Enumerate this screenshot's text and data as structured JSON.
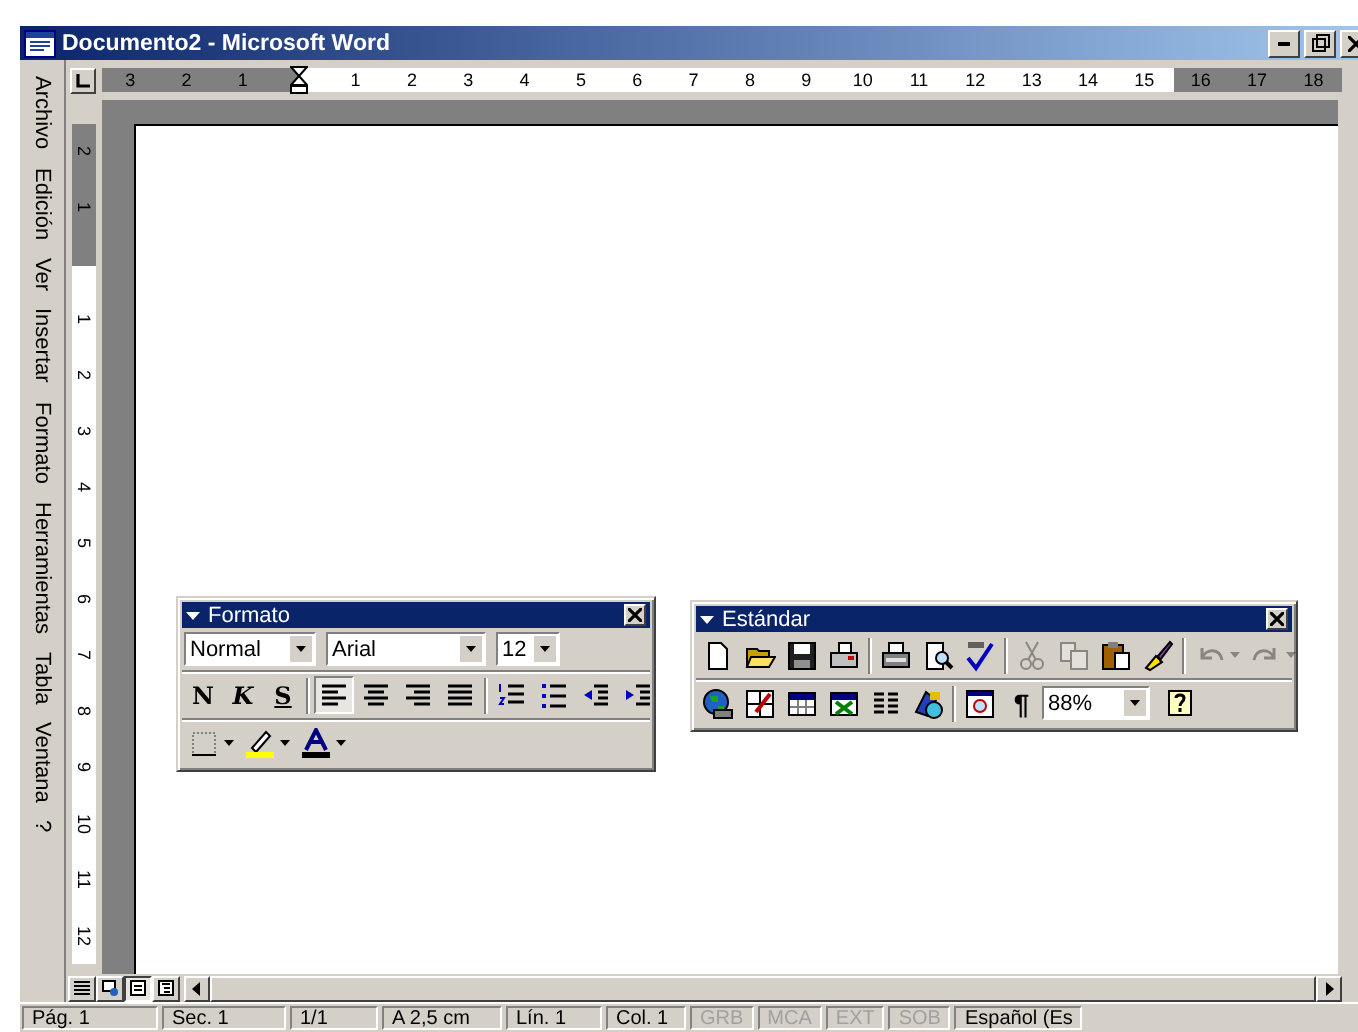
{
  "window": {
    "title": "Documento2 - Microsoft Word"
  },
  "menu": [
    {
      "label": "Archivo"
    },
    {
      "label": "Edición"
    },
    {
      "label": "Ver"
    },
    {
      "label": "Insertar"
    },
    {
      "label": "Formato"
    },
    {
      "label": "Herramientas"
    },
    {
      "label": "Tabla"
    },
    {
      "label": "Ventana"
    },
    {
      "label": "?"
    }
  ],
  "horizontal_ruler": {
    "labels": [
      "3",
      "2",
      "1",
      "1",
      "2",
      "3",
      "4",
      "5",
      "6",
      "7",
      "8",
      "9",
      "10",
      "11",
      "12",
      "13",
      "14",
      "15",
      "16",
      "17",
      "18"
    ]
  },
  "vertical_ruler": {
    "labels": [
      "2",
      "1",
      "1",
      "2",
      "3",
      "4",
      "5",
      "6",
      "7",
      "8",
      "9",
      "10",
      "11",
      "12"
    ]
  },
  "formatting_toolbar": {
    "title": "Formato",
    "rows": [
      [
        [
          {
            "kind": "dropdown",
            "value": "Normal"
          },
          {
            "kind": "dropdown",
            "value": "Arial"
          },
          {
            "kind": "dropdown",
            "value": "12"
          }
        ]
      ],
      [
        [
          {
            "kind": "text-button",
            "label": "N"
          },
          {
            "kind": "text-button",
            "label": "K"
          },
          {
            "kind": "text-button",
            "label": "S"
          }
        ],
        [
          {
            "kind": "button",
            "selected": true
          },
          {
            "kind": "button",
            "selected": false
          },
          {
            "kind": "button",
            "selected": false
          },
          {
            "kind": "button",
            "selected": false
          }
        ],
        [
          {
            "kind": "button",
            "disabled": false
          },
          {
            "kind": "button",
            "disabled": false
          },
          {
            "kind": "button",
            "disabled": false
          },
          {
            "kind": "button",
            "disabled": false
          }
        ]
      ],
      [
        [
          {
            "kind": "button",
            "disabled": false
          },
          {
            "kind": "button",
            "disabled": false
          },
          {
            "kind": "button",
            "disabled": false
          }
        ]
      ]
    ]
  },
  "standard_toolbar": {
    "title": "Estándar",
    "rows": [
      [
        [
          {
            "kind": "button",
            "disabled": false
          },
          {
            "kind": "button",
            "disabled": false
          },
          {
            "kind": "button",
            "disabled": false
          },
          {
            "kind": "button",
            "disabled": false
          }
        ],
        [
          {
            "kind": "button",
            "disabled": false
          },
          {
            "kind": "button",
            "disabled": false
          },
          {
            "kind": "button",
            "disabled": false
          }
        ],
        [
          {
            "kind": "button",
            "disabled": true
          },
          {
            "kind": "button",
            "disabled": true
          },
          {
            "kind": "button",
            "disabled": false
          },
          {
            "kind": "button",
            "disabled": false
          }
        ],
        [
          {
            "kind": "button",
            "disabled": true
          },
          {
            "kind": "button",
            "disabled": true
          }
        ]
      ],
      [
        [
          {
            "kind": "button",
            "disabled": false
          },
          {
            "kind": "button",
            "disabled": false
          },
          {
            "kind": "button",
            "disabled": false
          },
          {
            "kind": "button",
            "disabled": false
          },
          {
            "kind": "button",
            "disabled": false
          },
          {
            "kind": "button",
            "disabled": false
          }
        ],
        [
          {
            "kind": "button",
            "disabled": false
          },
          {
            "kind": "text-button",
            "label": "¶"
          },
          {
            "kind": "dropdown",
            "value": "88%"
          },
          {
            "kind": "button",
            "disabled": false
          }
        ]
      ]
    ]
  },
  "view_buttons": [
    {
      "selected": false
    },
    {
      "selected": false
    },
    {
      "selected": true
    },
    {
      "selected": false
    }
  ],
  "status_bar": [
    {
      "text": "Pág. 1",
      "disabled": false
    },
    {
      "text": "Sec. 1",
      "disabled": false
    },
    {
      "text": "1/1",
      "disabled": false
    },
    {
      "text": "A 2,5 cm",
      "disabled": false
    },
    {
      "text": "Lín. 1",
      "disabled": false
    },
    {
      "text": "Col. 1",
      "disabled": false
    },
    {
      "text": "GRB",
      "disabled": true
    },
    {
      "text": "MCA",
      "disabled": true
    },
    {
      "text": "EXT",
      "disabled": true
    },
    {
      "text": "SOB",
      "disabled": true
    },
    {
      "text": "Español (Es",
      "disabled": false
    }
  ]
}
